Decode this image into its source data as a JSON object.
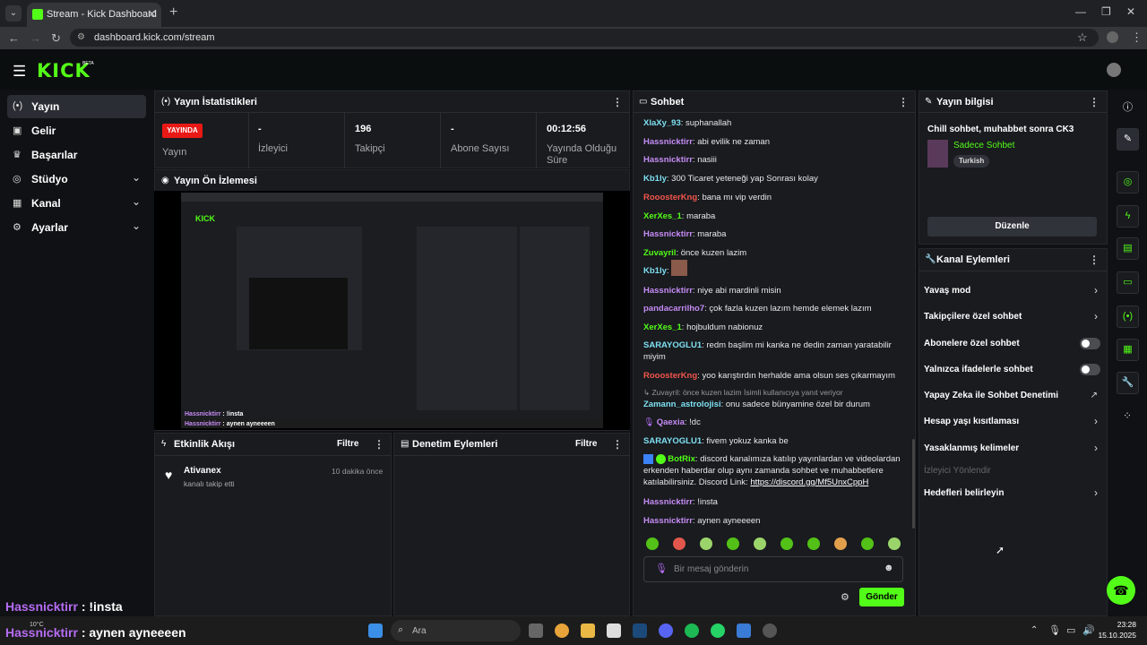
{
  "browser": {
    "tab_title": "Stream - Kick Dashboard",
    "url": "dashboard.kick.com/stream"
  },
  "header": {
    "logo": "KICK",
    "logo_badge": "BETA"
  },
  "sidebar": {
    "items": [
      {
        "label": "Yayın",
        "icon": "broadcast-icon"
      },
      {
        "label": "Gelir",
        "icon": "wallet-icon"
      },
      {
        "label": "Başarılar",
        "icon": "trophy-icon"
      },
      {
        "label": "Stüdyo",
        "icon": "studio-icon"
      },
      {
        "label": "Kanal",
        "icon": "channel-icon"
      },
      {
        "label": "Ayarlar",
        "icon": "gear-icon"
      }
    ]
  },
  "stats": {
    "title": "Yayın İstatistikleri",
    "live_badge": "YAYINDA",
    "status_label": "Yayın",
    "viewers_value": "-",
    "viewers_label": "İzleyici",
    "followers_value": "196",
    "followers_label": "Takipçi",
    "subs_value": "-",
    "subs_label": "Abone Sayısı",
    "uptime_value": "00:12:56",
    "uptime_label": "Yayında Olduğu Süre"
  },
  "preview": {
    "title": "Yayın Ön İzlemesi"
  },
  "activity": {
    "title": "Etkinlik Akışı",
    "filter": "Filtre",
    "events": [
      {
        "user": "Ativanex",
        "time": "10 dakika önce",
        "desc": "kanalı takip etti"
      }
    ]
  },
  "moderation": {
    "title": "Denetim Eylemleri",
    "filter": "Filtre"
  },
  "chat": {
    "title": "Sohbet",
    "input_placeholder": "Bir mesaj gönderin",
    "send": "Gönder",
    "discord_link": "https://discord.gg/Mf5UnxCppH",
    "reply_line": "Zuvayril: önce kuzen lazim İsimli kullanıcıya yanıt veriyor",
    "messages": [
      {
        "user": "XlaXy_93",
        "color": "#7ee0f2",
        "text": "suphanallah"
      },
      {
        "user": "Hassnicktirr",
        "color": "#c68cf5",
        "text": "abi evilik ne zaman"
      },
      {
        "user": "Hassnicktirr",
        "color": "#c68cf5",
        "text": "nasiii"
      },
      {
        "user": "Kb1ly",
        "color": "#7ee0f2",
        "text": "300 Ticaret yeteneği yap Sonrası kolay"
      },
      {
        "user": "RooosterKng",
        "color": "#f2554b",
        "text": "bana mı vip verdin"
      },
      {
        "user": "XerXes_1",
        "color": "#53fc18",
        "text": "maraba"
      },
      {
        "user": "Hassnicktirr",
        "color": "#c68cf5",
        "text": "maraba"
      },
      {
        "user": "Zuvayril",
        "color": "#53fc18",
        "text": "önce kuzen lazim"
      },
      {
        "user": "Kb1ly",
        "color": "#7ee0f2",
        "text": ""
      },
      {
        "user": "Hassnicktirr",
        "color": "#c68cf5",
        "text": "niye abi mardinli misin"
      },
      {
        "user": "pandacarrilho7",
        "color": "#c68cf5",
        "text": "çok fazla kuzen lazım hemde elemek lazım"
      },
      {
        "user": "XerXes_1",
        "color": "#53fc18",
        "text": "hojbuldum nabionuz"
      },
      {
        "user": "SARAYOGLU1",
        "color": "#7ee0f2",
        "text": "redm başlim mi kanka ne dedin zaman yaratabilir miyim"
      },
      {
        "user": "RooosterKng",
        "color": "#f2554b",
        "text": "yoo karıştırdın herhalde ama olsun ses çıkarmayım"
      },
      {
        "user": "Zamann_astrolojisi",
        "color": "#7ee0f2",
        "text": "onu sadece bünyamine özel bir durum"
      },
      {
        "user": "Qaexia",
        "color": "#c68cf5",
        "text": "!dc"
      },
      {
        "user": "SARAYOGLU1",
        "color": "#7ee0f2",
        "text": "fivem yokuz kanka be"
      },
      {
        "user": "BotRix",
        "color": "#53fc18",
        "text": "discord kanalımıza katılıp yayınlardan ve videolardan erkenden haberdar olup aynı zamanda sohbet ve muhabbetlere katılabilirsiniz. Discord Link:"
      },
      {
        "user": "Hassnicktirr",
        "color": "#c68cf5",
        "text": "!insta"
      },
      {
        "user": "Hassnicktirr",
        "color": "#c68cf5",
        "text": "aynen ayneeeen"
      }
    ]
  },
  "stream_info": {
    "title": "Yayın bilgisi",
    "stream_title": "Chill sohbet, muhabbet sonra CK3",
    "category": "Sadece Sohbet",
    "language": "Turkish",
    "edit": "Düzenle"
  },
  "channel_actions": {
    "title": "Kanal Eylemleri",
    "items": [
      {
        "label": "Yavaş mod",
        "control": "chevron"
      },
      {
        "label": "Takipçilere özel sohbet",
        "control": "chevron"
      },
      {
        "label": "Abonelere özel sohbet",
        "control": "toggle",
        "on": false
      },
      {
        "label": "Yalnızca ifadelerle sohbet",
        "control": "toggle",
        "on": false
      },
      {
        "label": "Yapay Zeka ile Sohbet Denetimi",
        "control": "external"
      },
      {
        "label": "Hesap yaşı kısıtlaması",
        "control": "chevron"
      },
      {
        "label": "Yasaklanmış kelimeler",
        "control": "chevron"
      },
      {
        "label": "İzleyici Yönlendir",
        "control": "disabled"
      },
      {
        "label": "Hedefleri belirleyin",
        "control": "chevron"
      }
    ]
  },
  "overlay": {
    "line1_user": "Hassnicktirr",
    "line1_text": ": !insta",
    "line2_user": "Hassnicktirr",
    "line2_text": ": aynen ayneeeen"
  },
  "taskbar": {
    "search": "Ara",
    "weather": "10°C",
    "time": "23:28",
    "date": "15.10.2025"
  },
  "colors": {
    "accent": "#53fc18",
    "live": "#e91916",
    "bg": "#0f1114",
    "panel": "#191b1f"
  }
}
